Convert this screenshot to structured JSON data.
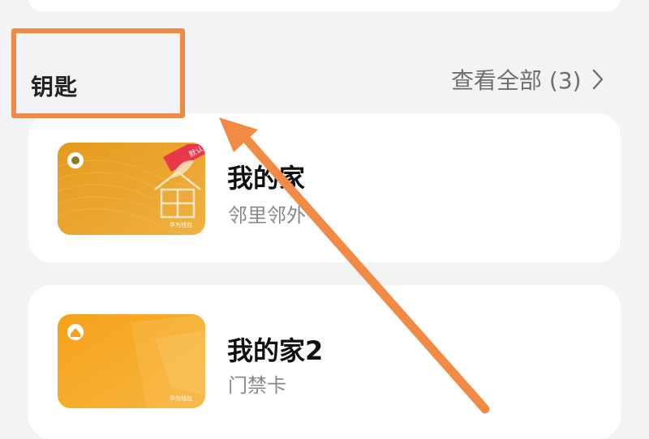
{
  "section": {
    "title": "钥匙",
    "view_all_label": "查看全部 (3)"
  },
  "keys": [
    {
      "name": "我的家",
      "subtitle": "邻里邻外",
      "badge": "默认",
      "card_brand": "华为钱包",
      "icon": "app-logo-icon"
    },
    {
      "name": "我的家2",
      "subtitle": "门禁卡",
      "card_brand": "华为钱包",
      "icon": "home-icon"
    }
  ],
  "colors": {
    "page_bg": "#f1f3f5",
    "card_bg": "#ffffff",
    "annotation_orange": "#f08a45",
    "card1_gradient_start": "#e59a1e",
    "card1_gradient_end": "#f0b343",
    "card2_gradient_start": "#f5a21a",
    "card2_gradient_end": "#f7b540",
    "badge_red": "#e8394a"
  }
}
